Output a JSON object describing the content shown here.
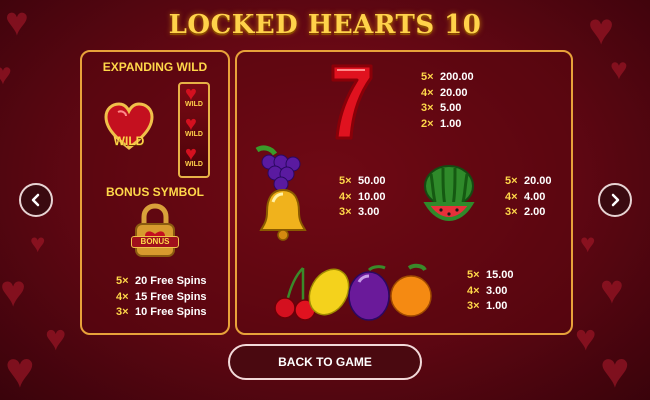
{
  "title": "LOCKED HEARTS 10",
  "expanding_wild": {
    "heading": "EXPANDING WILD",
    "wild_label": "WILD"
  },
  "bonus": {
    "heading": "BONUS SYMBOL",
    "badge": "BONUS",
    "payouts": [
      {
        "mult": "5×",
        "value": "20 Free Spins"
      },
      {
        "mult": "4×",
        "value": "15 Free Spins"
      },
      {
        "mult": "3×",
        "value": "10 Free Spins"
      }
    ]
  },
  "seven": {
    "payouts": [
      {
        "mult": "5×",
        "value": "200.00"
      },
      {
        "mult": "4×",
        "value": "20.00"
      },
      {
        "mult": "3×",
        "value": "5.00"
      },
      {
        "mult": "2×",
        "value": "1.00"
      }
    ]
  },
  "grapes_bell": {
    "payouts": [
      {
        "mult": "5×",
        "value": "50.00"
      },
      {
        "mult": "4×",
        "value": "10.00"
      },
      {
        "mult": "3×",
        "value": "3.00"
      }
    ]
  },
  "watermelon": {
    "payouts": [
      {
        "mult": "5×",
        "value": "20.00"
      },
      {
        "mult": "4×",
        "value": "4.00"
      },
      {
        "mult": "3×",
        "value": "2.00"
      }
    ]
  },
  "fruits": {
    "payouts": [
      {
        "mult": "5×",
        "value": "15.00"
      },
      {
        "mult": "4×",
        "value": "3.00"
      },
      {
        "mult": "3×",
        "value": "1.00"
      }
    ]
  },
  "back_button": "BACK TO GAME",
  "icons": {
    "prev": "chevron-left-icon",
    "next": "chevron-right-icon"
  },
  "colors": {
    "accent_gold": "#ffd84a",
    "panel_border": "#e8a23a",
    "background": "#6a0a16"
  }
}
